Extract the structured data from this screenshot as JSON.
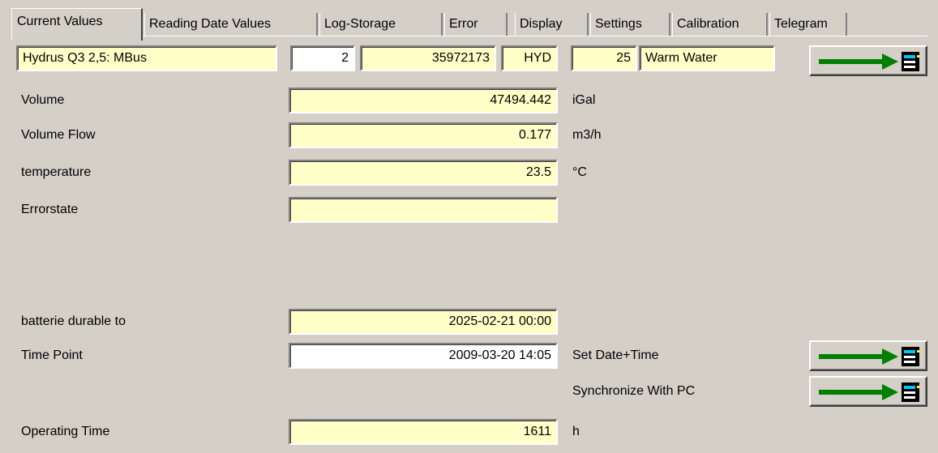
{
  "tabs": [
    {
      "label": "Current Values",
      "active": true
    },
    {
      "label": "Reading Date Values",
      "active": false
    },
    {
      "label": "Log-Storage",
      "active": false
    },
    {
      "label": "Error",
      "active": false
    },
    {
      "label": "Display",
      "active": false
    },
    {
      "label": "Settings",
      "active": false
    },
    {
      "label": "Calibration",
      "active": false
    },
    {
      "label": "Telegram",
      "active": false
    }
  ],
  "header": {
    "device": "Hydrus Q3 2,5: MBus",
    "address": "2",
    "serial": "35972173",
    "manufacturer": "HYD",
    "medium_code": "25",
    "medium": "Warm Water",
    "read_button_icon": "arrow-right-device-icon"
  },
  "rows": {
    "volume": {
      "label": "Volume",
      "value": "47494.442",
      "unit": "iGal"
    },
    "volume_flow": {
      "label": "Volume Flow",
      "value": "0.177",
      "unit": "m3/h"
    },
    "temperature": {
      "label": "temperature",
      "value": "23.5",
      "unit": "°C"
    },
    "errorstate": {
      "label": "Errorstate",
      "value": ""
    },
    "battery": {
      "label": "batterie durable to",
      "value": "2025-02-21 00:00"
    },
    "time_point": {
      "label": "Time Point",
      "value": "2009-03-20 14:05",
      "action": "Set Date+Time"
    },
    "sync": {
      "action": "Synchronize With PC"
    },
    "operating_time": {
      "label": "Operating Time",
      "value": "1611",
      "unit": "h"
    }
  },
  "colors": {
    "field_bg": "#ffffc8",
    "window_bg": "#d4d0c8",
    "arrow_green": "#008000"
  }
}
